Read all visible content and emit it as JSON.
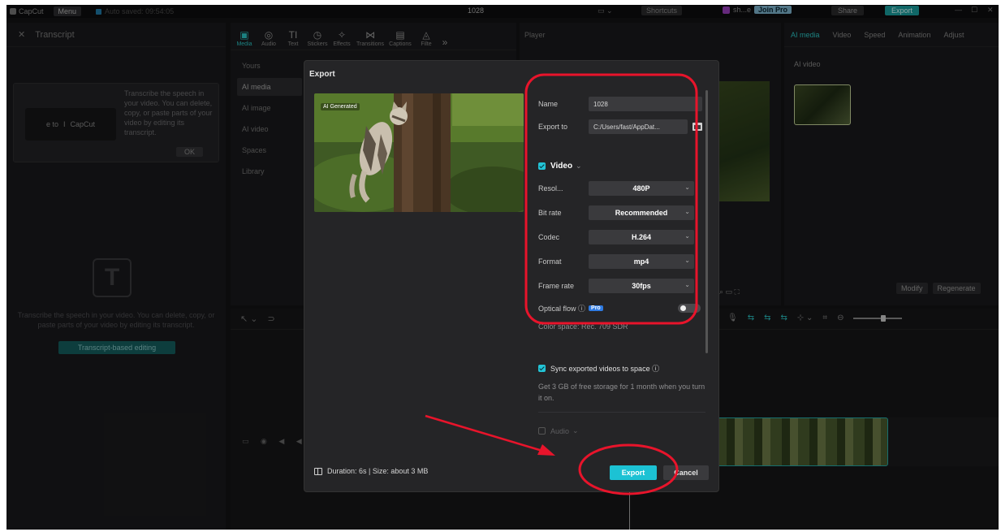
{
  "topbar": {
    "app_name": "CapCut",
    "menu_label": "Menu",
    "autosave": "Auto saved: 09:54:05",
    "project_title": "1028",
    "layout_icon": "layout-icon",
    "shortcuts_label": "Shortcuts",
    "user_name": "sh...e",
    "pro_label": "Join Pro",
    "share_label": "Share",
    "export_label": "Export",
    "win_min": "—",
    "win_max": "☐",
    "win_close": "✕"
  },
  "transcript": {
    "close_glyph": "✕",
    "title": "Transcript",
    "tip_left": "e to",
    "tip_brand": "CapCut",
    "tip_text": "Transcribe the speech in your video. You can delete, copy, or paste parts of your video by editing its transcript.",
    "ok_label": "OK",
    "desc": "Transcribe the speech in your video. You can delete, copy, or paste parts of your video by editing its transcript.",
    "button_label": "Transcript-based editing"
  },
  "media": {
    "tools": [
      {
        "label": "Media",
        "icon": "▣"
      },
      {
        "label": "Audio",
        "icon": "◎"
      },
      {
        "label": "Text",
        "icon": "TI"
      },
      {
        "label": "Stickers",
        "icon": "◷"
      },
      {
        "label": "Effects",
        "icon": "✧"
      },
      {
        "label": "Transitions",
        "icon": "⋈"
      },
      {
        "label": "Captions",
        "icon": "▤"
      },
      {
        "label": "Filte",
        "icon": "◬"
      }
    ],
    "more_glyph": "»",
    "side_items": [
      "Yours",
      "AI media",
      "AI image",
      "AI video",
      "Spaces",
      "Library"
    ]
  },
  "player": {
    "title": "Player"
  },
  "details": {
    "tabs": [
      "AI media",
      "Video",
      "Speed",
      "Animation",
      "Adjust"
    ],
    "section": "AI video",
    "modify_label": "Modify",
    "regenerate_label": "Regenerate"
  },
  "timeline": {
    "tools": [
      "↖ ⌄",
      "⊃"
    ],
    "right_tools": [
      "⇆",
      "⇆",
      "⇆",
      "⊹ ⌄",
      "⌗",
      "⊖"
    ]
  },
  "export_dialog": {
    "title": "Export",
    "ai_badge": "AI Generated",
    "name_label": "Name",
    "name_value": "1028",
    "export_to_label": "Export to",
    "export_to_value": "C:/Users/fast/AppDat...",
    "video_section": "Video",
    "resolution_label": "Resol...",
    "resolution_value": "480P",
    "bitrate_label": "Bit rate",
    "bitrate_value": "Recommended",
    "codec_label": "Codec",
    "codec_value": "H.264",
    "format_label": "Format",
    "format_value": "mp4",
    "framerate_label": "Frame rate",
    "framerate_value": "30fps",
    "optical_flow_label": "Optical flow ⓘ",
    "pro_badge": "Pro",
    "color_space_text": "Color space: Rec. 709 SDR",
    "sync_label": "Sync exported videos to space ⓘ",
    "sync_desc": "Get 3 GB of free storage for 1 month when you turn it on.",
    "audio_section": "Audio",
    "footer_text": "Duration: 6s | Size: about 3 MB",
    "export_button": "Export",
    "cancel_button": "Cancel"
  },
  "annotation_colors": {
    "highlight": "#e8142b"
  }
}
